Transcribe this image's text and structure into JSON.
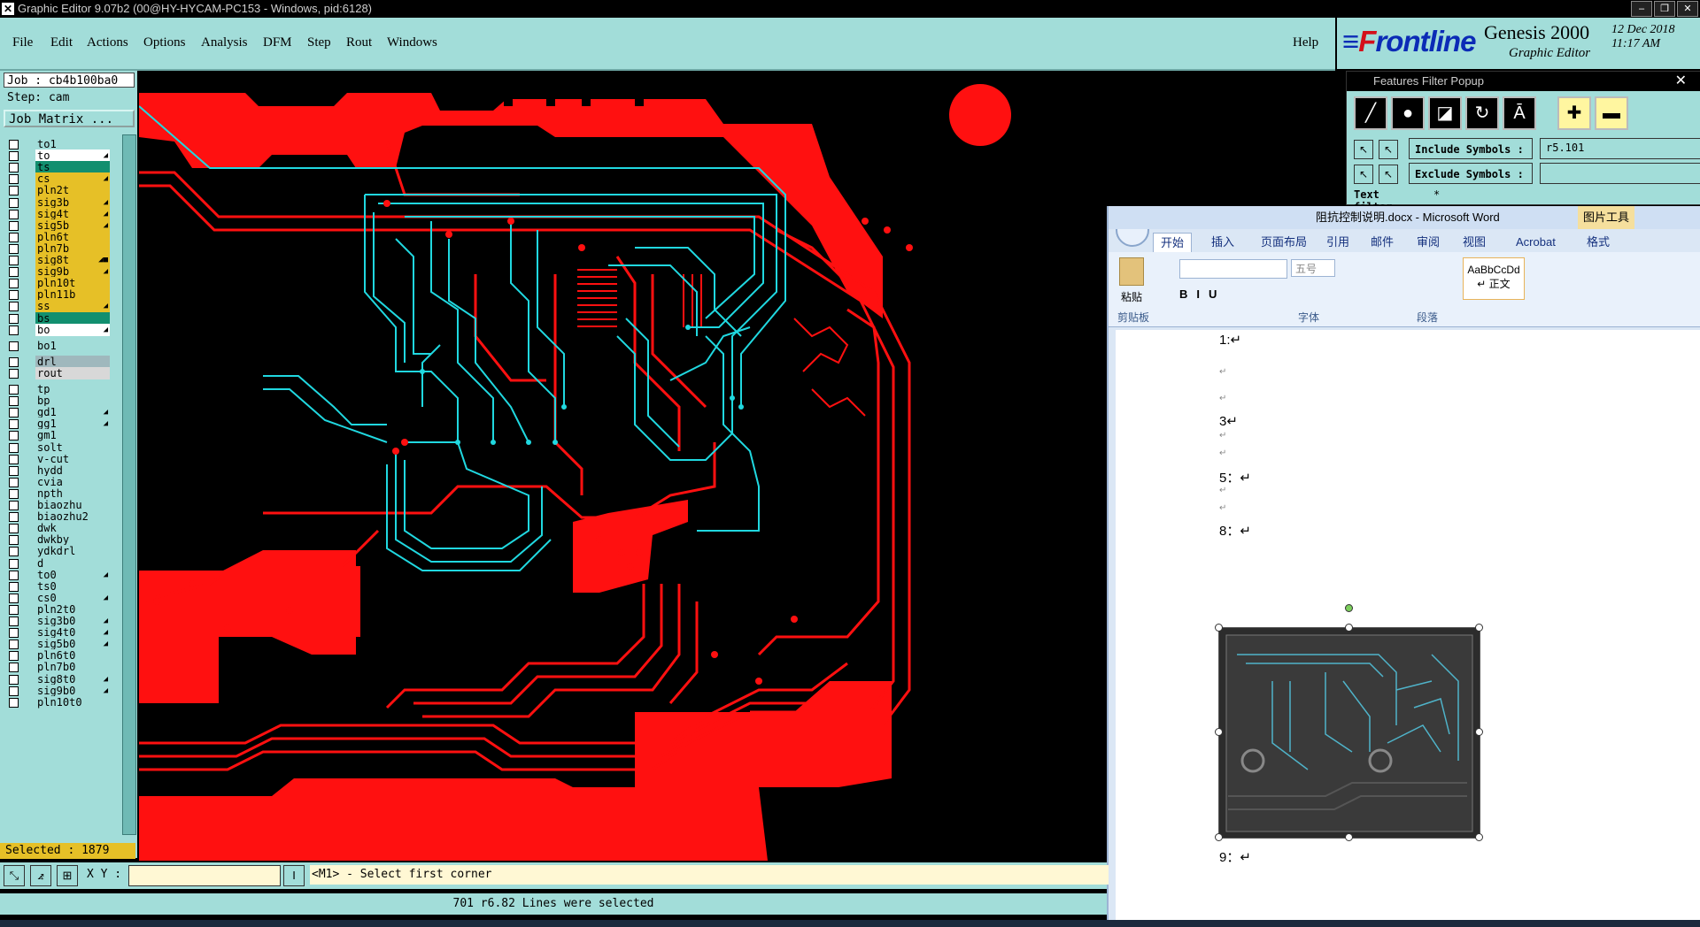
{
  "titlebar": {
    "text": "Graphic Editor 9.07b2 (00@HY-HYCAM-PC153 - Windows, pid:6128)"
  },
  "menu": [
    "File",
    "Edit",
    "Actions",
    "Options",
    "Analysis",
    "DFM",
    "Step",
    "Rout",
    "Windows"
  ],
  "help": "Help",
  "brand": {
    "logo_f": "F",
    "logo_rest": "rontline",
    "product": "Genesis 2000",
    "sub": "Graphic Editor",
    "date": "12 Dec 2018",
    "time": "11:17 AM"
  },
  "job": "Job : cb4b100ba0",
  "step": "Step: cam",
  "job_matrix": "Job Matrix ...",
  "layers": [
    {
      "name": "to1",
      "color": "#a2ddd9",
      "mark": ""
    },
    {
      "name": "to",
      "color": "#ffffff",
      "mark": "◢"
    },
    {
      "name": "ts",
      "color": "#128f6f",
      "mark": ""
    },
    {
      "name": "cs",
      "color": "#e6c027",
      "mark": "◢"
    },
    {
      "name": "pln2t",
      "color": "#e6c027",
      "mark": ""
    },
    {
      "name": "sig3b",
      "color": "#e6c027",
      "mark": "◢"
    },
    {
      "name": "sig4t",
      "color": "#e6c027",
      "mark": "◢"
    },
    {
      "name": "sig5b",
      "color": "#e6c027",
      "mark": "◢"
    },
    {
      "name": "pln6t",
      "color": "#e6c027",
      "mark": ""
    },
    {
      "name": "pln7b",
      "color": "#e6c027",
      "mark": ""
    },
    {
      "name": "sig8t",
      "color": "#e6c027",
      "mark": "◢■"
    },
    {
      "name": "sig9b",
      "color": "#e6c027",
      "mark": "◢"
    },
    {
      "name": "pln10t",
      "color": "#e6c027",
      "mark": ""
    },
    {
      "name": "pln11b",
      "color": "#e6c027",
      "mark": ""
    },
    {
      "name": "ss",
      "color": "#e6c027",
      "mark": "◢"
    },
    {
      "name": "bs",
      "color": "#128f6f",
      "mark": ""
    },
    {
      "name": "bo",
      "color": "#ffffff",
      "mark": "◢"
    },
    {
      "name": "bo1",
      "color": "#a2ddd9",
      "mark": ""
    },
    {
      "name": "drl",
      "color": "#9fb8bd",
      "mark": ""
    },
    {
      "name": "rout",
      "color": "#d8d8d8",
      "mark": ""
    },
    {
      "name": "tp",
      "color": "#a2ddd9",
      "mark": ""
    },
    {
      "name": "bp",
      "color": "#a2ddd9",
      "mark": ""
    },
    {
      "name": "gd1",
      "color": "#a2ddd9",
      "mark": "◢"
    },
    {
      "name": "gg1",
      "color": "#a2ddd9",
      "mark": "◢"
    },
    {
      "name": "gm1",
      "color": "#a2ddd9",
      "mark": ""
    },
    {
      "name": "solt",
      "color": "#a2ddd9",
      "mark": ""
    },
    {
      "name": "v-cut",
      "color": "#a2ddd9",
      "mark": ""
    },
    {
      "name": "hydd",
      "color": "#a2ddd9",
      "mark": ""
    },
    {
      "name": "cvia",
      "color": "#a2ddd9",
      "mark": ""
    },
    {
      "name": "npth",
      "color": "#a2ddd9",
      "mark": ""
    },
    {
      "name": "biaozhu",
      "color": "#a2ddd9",
      "mark": ""
    },
    {
      "name": "biaozhu2",
      "color": "#a2ddd9",
      "mark": ""
    },
    {
      "name": "dwk",
      "color": "#a2ddd9",
      "mark": ""
    },
    {
      "name": "dwkby",
      "color": "#a2ddd9",
      "mark": ""
    },
    {
      "name": "ydkdrl",
      "color": "#a2ddd9",
      "mark": ""
    },
    {
      "name": "d",
      "color": "#a2ddd9",
      "mark": ""
    },
    {
      "name": "to0",
      "color": "#a2ddd9",
      "mark": "◢"
    },
    {
      "name": "ts0",
      "color": "#a2ddd9",
      "mark": ""
    },
    {
      "name": "cs0",
      "color": "#a2ddd9",
      "mark": "◢"
    },
    {
      "name": "pln2t0",
      "color": "#a2ddd9",
      "mark": ""
    },
    {
      "name": "sig3b0",
      "color": "#a2ddd9",
      "mark": "◢"
    },
    {
      "name": "sig4t0",
      "color": "#a2ddd9",
      "mark": "◢"
    },
    {
      "name": "sig5b0",
      "color": "#a2ddd9",
      "mark": "◢"
    },
    {
      "name": "pln6t0",
      "color": "#a2ddd9",
      "mark": ""
    },
    {
      "name": "pln7b0",
      "color": "#a2ddd9",
      "mark": ""
    },
    {
      "name": "sig8t0",
      "color": "#a2ddd9",
      "mark": "◢"
    },
    {
      "name": "sig9b0",
      "color": "#a2ddd9",
      "mark": "◢"
    },
    {
      "name": "pln10t0",
      "color": "#a2ddd9",
      "mark": ""
    }
  ],
  "selected": "Selected : 1879",
  "filter_popup": {
    "title": "Features Filter Popup",
    "include_label": "Include Symbols :",
    "include_value": "r5.101",
    "exclude_label": "Exclude Symbols :",
    "exclude_value": "",
    "text_filter_label": "Text filter",
    "text_filter_value": "*"
  },
  "word": {
    "title": "阻抗控制说明.docx - Microsoft Word",
    "picture_tools": "图片工具",
    "tabs": [
      "开始",
      "插入",
      "页面布局",
      "引用",
      "邮件",
      "审阅",
      "视图",
      "Acrobat",
      "格式"
    ],
    "groups": [
      "剪贴板",
      "字体",
      "段落"
    ],
    "paste": "粘贴",
    "font_size": "五号",
    "style_name": "AaBbCcDd",
    "style_label": "↵ 正文",
    "paragraphs": [
      "1:↵",
      "↵",
      "↵",
      "3↵",
      "↵",
      "↵",
      "5：↵",
      "↵",
      "↵",
      "8：↵",
      "9：↵"
    ]
  },
  "cmd": {
    "xy_label": "X Y :",
    "prompt": "<M1> - Select first corner"
  },
  "status": "701 r6.82 Lines were selected",
  "colors": {
    "panel": "#a2ddd9",
    "red_layer": "#ff1010",
    "cyan_layer": "#20d8e0"
  }
}
